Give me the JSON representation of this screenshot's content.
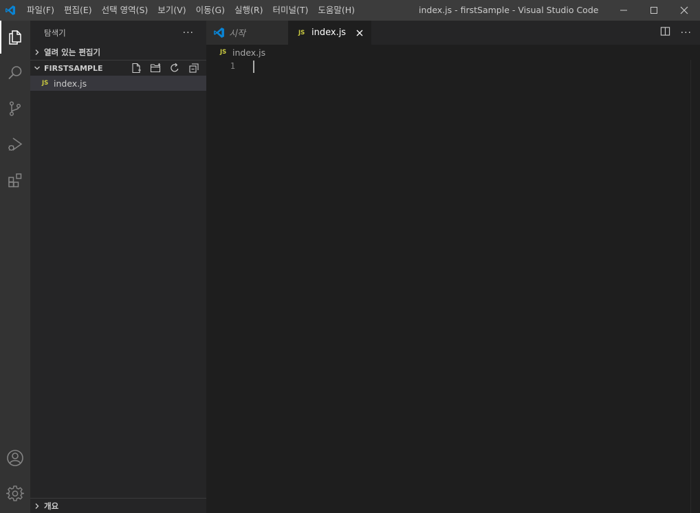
{
  "window": {
    "title": "index.js - firstSample - Visual Studio Code"
  },
  "menu": [
    "파일(F)",
    "편집(E)",
    "선택 영역(S)",
    "보기(V)",
    "이동(G)",
    "실행(R)",
    "터미널(T)",
    "도움말(H)"
  ],
  "activity_bar": {
    "top_icons": [
      "explorer-icon",
      "search-icon",
      "source-control-icon",
      "run-debug-icon",
      "extensions-icon"
    ],
    "bottom_icons": [
      "account-icon",
      "gear-icon"
    ],
    "active": "explorer-icon"
  },
  "sidebar": {
    "title": "탐색기",
    "open_editors_label": "열려 있는 편집기",
    "folder_name": "FIRSTSAMPLE",
    "files": [
      {
        "badge": "JS",
        "name": "index.js",
        "selected": true
      }
    ],
    "outline_label": "개요"
  },
  "editor": {
    "tabs": [
      {
        "label": "시작",
        "active": false,
        "icon": "vscode-icon"
      },
      {
        "label": "index.js",
        "active": true,
        "badge": "JS"
      }
    ],
    "breadcrumb": {
      "badge": "JS",
      "file": "index.js"
    },
    "lines": [
      "1"
    ]
  },
  "colors": {
    "titlebar": "#3c3c3c",
    "activity_bar": "#333333",
    "sidebar": "#252526",
    "editor": "#1e1e1e",
    "vscode_blue": "#0a84d4",
    "js_yellow": "#cbcb41"
  }
}
